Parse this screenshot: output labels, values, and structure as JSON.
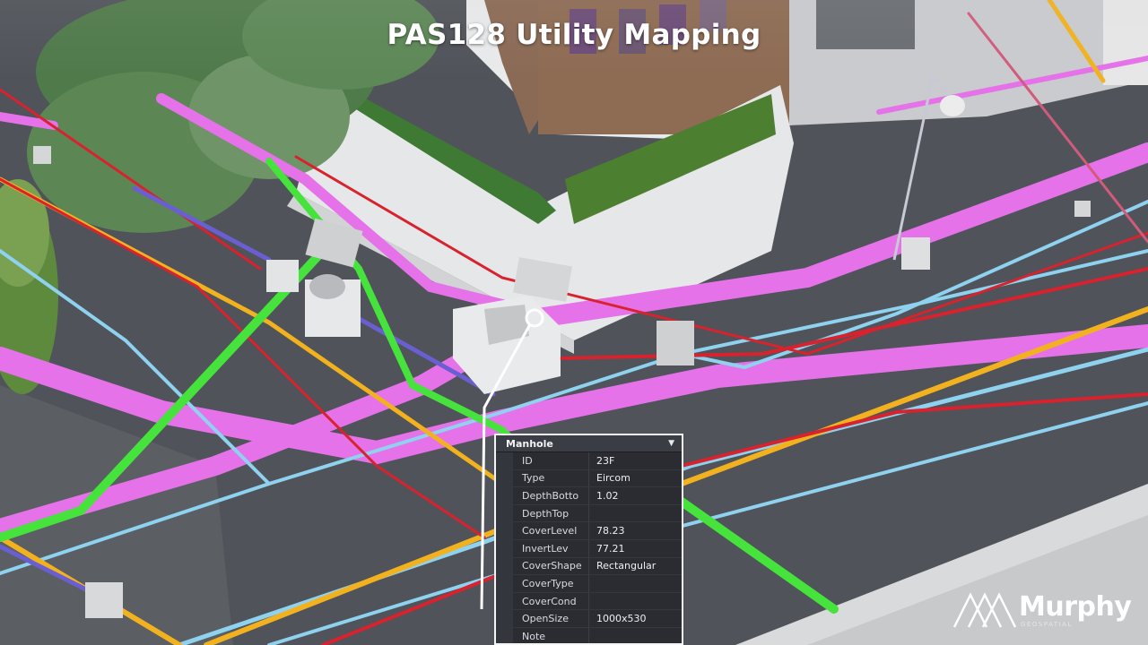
{
  "title": "PAS128 Utility Mapping",
  "panel": {
    "header": "Manhole",
    "rows": [
      {
        "key": "ID",
        "value": "23F"
      },
      {
        "key": "Type",
        "value": "Eircom"
      },
      {
        "key": "DepthBotto",
        "value": "1.02"
      },
      {
        "key": "DepthTop",
        "value": ""
      },
      {
        "key": "CoverLevel",
        "value": "78.23"
      },
      {
        "key": "InvertLev",
        "value": "77.21"
      },
      {
        "key": "CoverShape",
        "value": "Rectangular"
      },
      {
        "key": "CoverType",
        "value": ""
      },
      {
        "key": "CoverCond",
        "value": ""
      },
      {
        "key": "OpenSize",
        "value": "1000x530"
      },
      {
        "key": "Note",
        "value": ""
      }
    ]
  },
  "logo": {
    "name": "Murphy",
    "sub": "GEOSPATIAL"
  },
  "colors": {
    "telecom_pink": "#e572e8",
    "water_cyan": "#8fd2f0",
    "gas_yellow": "#f2b21f",
    "electric_red": "#d8222d",
    "fibre_green": "#45e33b",
    "sewer_purple": "#6a5fd1"
  }
}
